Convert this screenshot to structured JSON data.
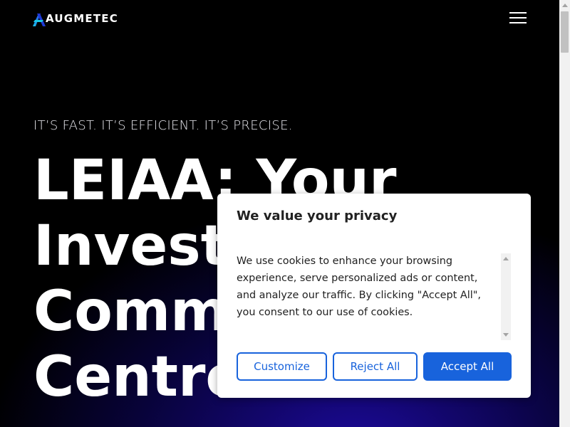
{
  "header": {
    "logo_text": "AUGMETEC",
    "menu_icon": "hamburger-menu-icon"
  },
  "hero": {
    "tagline": "IT’S FAST. IT’S EFFICIENT. IT’S PRECISE.",
    "title_lines": [
      "LEIAA: Your",
      "Investi",
      "Comm",
      "Centre"
    ]
  },
  "cookie_banner": {
    "title": "We value your privacy",
    "body": "We use cookies to enhance your browsing experience, serve personalized ads or content, and analyze our traffic. By clicking \"Accept All\", you consent to our use of cookies.",
    "buttons": {
      "customize": "Customize",
      "reject": "Reject All",
      "accept": "Accept All"
    }
  },
  "colors": {
    "accent": "#1863dc",
    "logo_cyan": "#19c6e6",
    "logo_blue": "#2a3cf0"
  }
}
